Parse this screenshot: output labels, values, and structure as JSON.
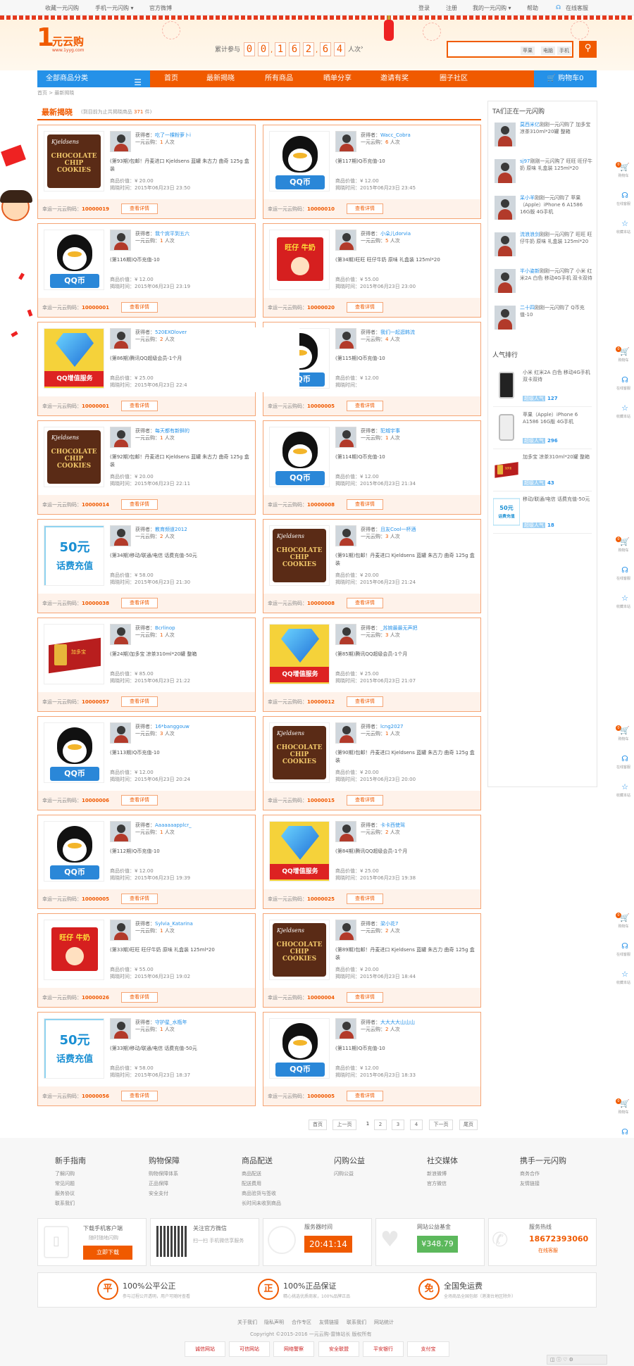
{
  "topbar": {
    "left": [
      "收藏一元闪购",
      "手机一元闪购 ▾",
      "官方微博"
    ],
    "right": [
      "登录",
      "注册",
      "我的一元闪购 ▾",
      "帮助",
      "在线客服"
    ]
  },
  "header": {
    "logo_big": "1",
    "logo_name": "元云购",
    "logo_url": "www.1yyg.com",
    "counter_label": "累计参与",
    "counter_digits": [
      "0",
      "0",
      "1",
      "6",
      "2",
      "6",
      "4"
    ],
    "counter_unit": "人次",
    "search_placeholder": "",
    "search_tags": [
      "苹果",
      "电脑",
      "手机"
    ],
    "search_icon": "search-icon"
  },
  "nav": {
    "category": "全部商品分类",
    "items": [
      "首页",
      "最新揭晓",
      "所有商品",
      "晒单分享",
      "邀请有奖",
      "圈子社区"
    ],
    "cart": "购物车0"
  },
  "breadcrumb": "首页 > 最新揭晓",
  "section": {
    "title": "最新揭晓",
    "subtitle_prefix": "(到目前为止共揭晓商品",
    "count": "371",
    "subtitle_suffix": "件)"
  },
  "labels": {
    "winner": "获得者：",
    "joined_prefix": "一元云购：",
    "joined_suffix": "人次",
    "price": "商品价值：",
    "time": "揭晓时间：",
    "lucky": "幸运一元云购码：",
    "detail": "查看详情"
  },
  "cards": [
    {
      "img": "choc",
      "winner": "吃了一棵粉萝卜i",
      "count": "1",
      "title": "(第93期)包邮！丹麦进口 Kjeldsens 蓝罐 朱古力 曲奇 125g 盒装",
      "price": "¥ 20.00",
      "time": "2015年06月23日 23:50",
      "code": "10000019"
    },
    {
      "img": "qq",
      "winner": "Wacc_Cobra",
      "count": "6",
      "title": "(第117期)Q币充值-10",
      "price": "¥ 12.00",
      "time": "2015年06月23日 23:45",
      "code": "10000010"
    },
    {
      "img": "qq",
      "winner": "我个宾平到五六",
      "count": "1",
      "title": "(第116期)Q币充值-10",
      "price": "¥ 12.00",
      "time": "2015年06月23日 23:19",
      "code": "10000001"
    },
    {
      "img": "milk",
      "winner": "小朵儿dorvia",
      "count": "5",
      "title": "(第34期)旺旺 旺仔牛奶 原味 礼盒装 125ml*20",
      "price": "¥ 55.00",
      "time": "2015年06月23日 23:00",
      "code": "10000020"
    },
    {
      "img": "qqvip",
      "winner": "520EXOloverly",
      "count": "2",
      "title": "(第86期)腾讯QQ超级会员-1个月",
      "price": "¥ 25.00",
      "time": "2015年06月23日 22:4",
      "code": "10000001"
    },
    {
      "img": "qq",
      "winner": "我们一起逛韩流",
      "count": "4",
      "title": "(第115期)Q币充值-10",
      "price": "¥ 12.00",
      "time": "",
      "code": "10000005"
    },
    {
      "img": "choc",
      "winner": "每天都有新鲜的",
      "count": "1",
      "title": "(第92期)包邮！丹麦进口 Kjeldsens 蓝罐 朱古力 曲奇 125g 盒装",
      "price": "¥ 20.00",
      "time": "2015年06月23日 22:11",
      "code": "10000014"
    },
    {
      "img": "qq",
      "winner": "犯城宇事",
      "count": "1",
      "title": "(第114期)Q币充值-10",
      "price": "¥ 12.00",
      "time": "2015年06月23日 21:34",
      "code": "10000008"
    },
    {
      "img": "fee",
      "winner": "教育频道2012",
      "count": "2",
      "title": "(第34期)移动/联通/电信 话费充值-50元",
      "price": "¥ 58.00",
      "time": "2015年06月23日 21:30",
      "code": "10000038"
    },
    {
      "img": "choc",
      "winner": "且友Cool一杯酒",
      "count": "3",
      "title": "(第91期)包邮！丹麦进口 Kjeldsens 蓝罐 朱古力 曲奇 125g 盒装",
      "price": "¥ 20.00",
      "time": "2015年06月23日 21:24",
      "code": "10000008"
    },
    {
      "img": "tea",
      "winner": "Bcrlinop",
      "count": "1",
      "title": "(第24期)加多宝 凉茶310ml*20罐 整箱",
      "price": "¥ 85.00",
      "time": "2015年06月23日 21:22",
      "code": "10000057"
    },
    {
      "img": "qqvip",
      "winner": "_苏婉最最无声把",
      "count": "3",
      "title": "(第85期)腾讯QQ超级会员-1个月",
      "price": "¥ 25.00",
      "time": "2015年06月23日 21:07",
      "code": "10000012"
    },
    {
      "img": "qq",
      "winner": "16*banggouw",
      "count": "3",
      "title": "(第113期)Q币充值-10",
      "price": "¥ 12.00",
      "time": "2015年06月23日 20:24",
      "code": "10000006"
    },
    {
      "img": "choc",
      "winner": "lcng2027",
      "count": "1",
      "title": "(第90期)包邮！丹麦进口 Kjeldsens 蓝罐 朱古力 曲奇 125g 盒装",
      "price": "¥ 20.00",
      "time": "2015年06月23日 20:00",
      "code": "10000015"
    },
    {
      "img": "qq",
      "winner": "Aaaaaaapplcr_",
      "count": "1",
      "title": "(第112期)Q币充值-10",
      "price": "¥ 12.00",
      "time": "2015年06月23日 19:39",
      "code": "10000005"
    },
    {
      "img": "qqvip",
      "winner": "卡卡西使驾",
      "count": "2",
      "title": "(第84期)腾讯QQ超级会员-1个月",
      "price": "¥ 25.00",
      "time": "2015年06月23日 19:38",
      "code": "10000025"
    },
    {
      "img": "milk",
      "winner": "Sylvia_Katarina",
      "count": "1",
      "title": "(第33期)旺旺 旺仔牛奶 原味 礼盒装 125ml*20",
      "price": "¥ 55.00",
      "time": "2015年06月23日 19:02",
      "code": "10000026"
    },
    {
      "img": "choc",
      "winner": "梁小花7",
      "count": "2",
      "title": "(第89期)包邮！丹麦进口 Kjeldsens 蓝罐 朱古力 曲奇 125g 盒装",
      "price": "¥ 20.00",
      "time": "2015年06月23日 18:44",
      "code": "10000004"
    },
    {
      "img": "fee",
      "winner": "守护星_水瓶年",
      "count": "1",
      "title": "(第33期)移动/联通/电信 话费充值-50元",
      "price": "¥ 58.00",
      "time": "2015年06月23日 18:37",
      "code": "10000056"
    },
    {
      "img": "qq",
      "winner": "大大大大山山山",
      "count": "2",
      "title": "(第111期)Q币充值-10",
      "price": "¥ 12.00",
      "time": "2015年06月23日 18:33",
      "code": "10000005"
    }
  ],
  "sidebar": {
    "buying_title": "TA们正在一元闪购",
    "buying": [
      {
        "user": "莫西米亿",
        "text": "刚刚一元闪购了 加多宝 凉茶310ml*20罐 整箱"
      },
      {
        "user": "sj97",
        "text": "刚刚一元闪购了 旺旺 旺仔牛奶 原味 礼盒装 125ml*20"
      },
      {
        "user": "呆小羊",
        "text": "刚刚一元闪购了 苹果（Apple）iPhone 6 A1586 16G版 4G手机"
      },
      {
        "user": "流浪浪剑",
        "text": "刚刚一元闪购了 旺旺 旺仔牛奶 原味 礼盒装 125ml*20"
      },
      {
        "user": "半小姿新",
        "text": "刚刚一元闪购了 小米 红米2A 白色 移动4G手机 双卡双待"
      },
      {
        "user": "二十四",
        "text": "刚刚一元闪购了 Q币充值-10"
      }
    ],
    "pop_title": "人气排行",
    "pop_label": "超级人气",
    "popular": [
      {
        "img": "phone",
        "text": "小米 红米2A 白色 移动4G手机 双卡双待",
        "count": "127"
      },
      {
        "img": "iphone",
        "text": "苹果（Apple）iPhone 6 A1586 16G版 4G手机",
        "count": "296"
      },
      {
        "img": "tea",
        "text": "加多宝 凉茶310ml*20罐 整箱",
        "count": "43"
      },
      {
        "img": "fee",
        "text": "移动/联通/电信 话费充值-50元",
        "count": "18"
      }
    ]
  },
  "floatbar": [
    "购物车",
    "在线客服",
    "收藏本站"
  ],
  "pagination": [
    "首页",
    "上一页",
    "1",
    "2",
    "3",
    "4",
    "下一页",
    "尾页"
  ],
  "footer": {
    "cols": [
      {
        "title": "新手指南",
        "items": [
          "了解闪购",
          "常见问题",
          "服务协议",
          "联系我们"
        ]
      },
      {
        "title": "购物保障",
        "items": [
          "购物保障体系",
          "正品保障",
          "安全支付"
        ]
      },
      {
        "title": "商品配送",
        "items": [
          "商品配送",
          "配送费用",
          "商品验货与签收",
          "长时间未收到商品"
        ]
      },
      {
        "title": "闪购公益",
        "items": [
          "闪购公益"
        ]
      },
      {
        "title": "社交媒体",
        "items": [
          "新浪微博",
          "官方微信"
        ]
      },
      {
        "title": "携手一元闪购",
        "items": [
          "商务合作",
          "友情链接"
        ]
      }
    ],
    "app_title": "下载手机客户端",
    "app_sub": "随时随地闪购",
    "app_btn": "立即下载",
    "wechat_title": "关注官方微信",
    "wechat_sub": "扫一扫 手机微信享服务",
    "server_title": "服务器时间",
    "server_time": "20:41:14",
    "fund_title": "网站公益基金",
    "fund_value": "¥348.79",
    "hotline_title": "服务热线",
    "hotline": "18672393060",
    "online": "在线客服",
    "pledges": [
      {
        "icon": "平",
        "title": "100%公平公正",
        "sub": "参与过程公开透明，用户可随时查看"
      },
      {
        "icon": "正",
        "title": "100%正品保证",
        "sub": "精心挑选优质商家，100%品牌正品"
      },
      {
        "icon": "免",
        "title": "全国免运费",
        "sub": "全场商品全国包邮（港澳台地区除外）"
      }
    ],
    "links": [
      "关于我们",
      "隐私声明",
      "合作专区",
      "友情链接",
      "联系我们",
      "网站统计"
    ],
    "copyright": "Copyright ©2015-2016 一元云购-雷锋站长 版权所有",
    "certs": [
      "诚信网站",
      "可信网站",
      "网络警察",
      "安全联盟",
      "平安银行",
      "支付宝"
    ]
  },
  "colors": {
    "accent": "#f05a00",
    "blue": "#2591e8",
    "border": "#f5a575"
  }
}
